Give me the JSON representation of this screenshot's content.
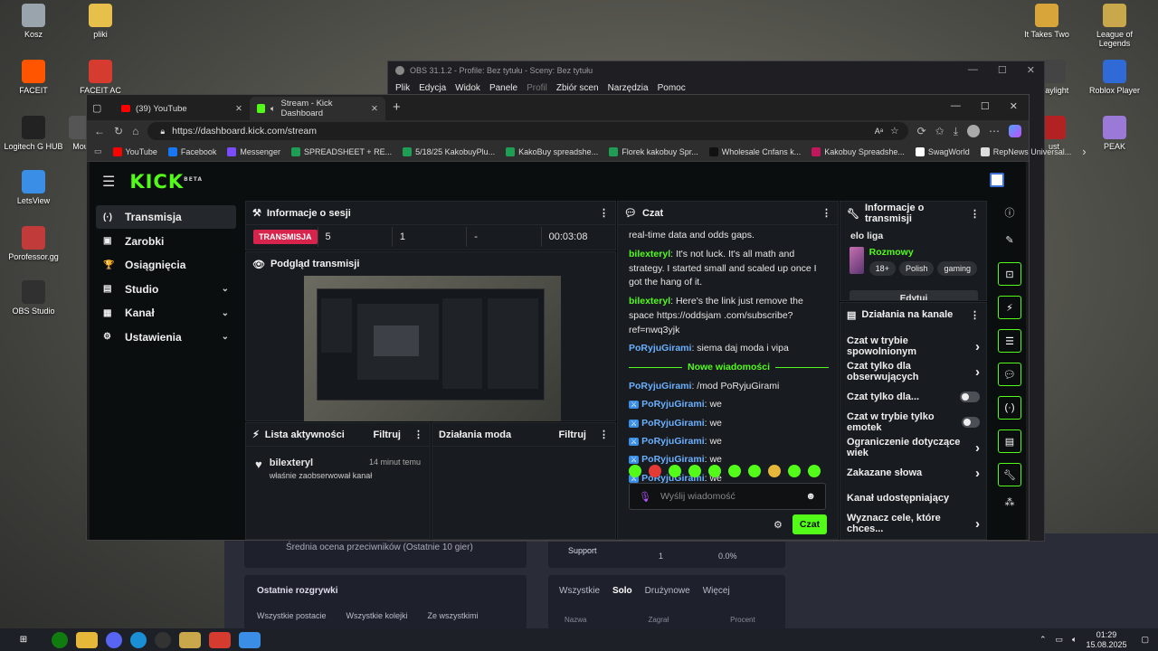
{
  "desktop": {
    "left_icons": [
      {
        "label": "Kosz",
        "color": "#9aa4ad"
      },
      {
        "label": "pliki",
        "color": "#e6c04a"
      },
      {
        "label": "FACEIT",
        "color": "#ff5500"
      },
      {
        "label": "FACEIT AC",
        "color": "#d63b2f"
      },
      {
        "label": "Logitech G HUB",
        "color": "#222222"
      },
      {
        "label": "Mou",
        "color": "#555555"
      },
      {
        "label": "LetsView",
        "color": "#3a8ee6"
      },
      {
        "label": "Porofessor.gg",
        "color": "#c23b3b"
      },
      {
        "label": "OBS Studio",
        "color": "#303030"
      }
    ],
    "right_icons": [
      {
        "label": "It Takes Two",
        "color": "#d8a53a"
      },
      {
        "label": "League of Legends",
        "color": "#c8a84a"
      },
      {
        "label": "Daylight",
        "color": "#444444"
      },
      {
        "label": "Roblox Player",
        "color": "#2f6ad6"
      },
      {
        "label": "ust",
        "color": "#b22222"
      },
      {
        "label": "PEAK",
        "color": "#9a7ad6"
      }
    ]
  },
  "obs": {
    "title": "OBS 31.1.2 - Profile: Bez tytułu - Sceny: Bez tytułu",
    "menu": [
      "Plik",
      "Edycja",
      "Widok",
      "Panele",
      "Profil",
      "Zbiór scen",
      "Narzędzia",
      "Pomoc"
    ]
  },
  "game_bg": {
    "avg_rating": "Średnia ocena przeciwników (Ostatnie 10 gier)",
    "recent_games": "Ostatnie rozgrywki",
    "filters": [
      "Wszystkie postacie",
      "Wszystkie kolejki",
      "Ze wszystkimi"
    ],
    "role": "Support",
    "role_value": "1",
    "role_pct": "0.0%",
    "tabs": [
      "Wszystkie",
      "Solo",
      "Drużynowe",
      "Więcej"
    ],
    "cols": [
      "Nazwa",
      "Zagrał",
      "Procent"
    ]
  },
  "browser": {
    "tabs": [
      {
        "label": "(39) YouTube",
        "active": false
      },
      {
        "label": "Stream - Kick Dashboard",
        "active": true
      }
    ],
    "url": "https://dashboard.kick.com/stream",
    "bookmarks": [
      {
        "label": "YouTube",
        "color": "#ff0000"
      },
      {
        "label": "Facebook",
        "color": "#1877f2"
      },
      {
        "label": "Messenger",
        "color": "#7b4bff"
      },
      {
        "label": "SPREADSHEET + RE...",
        "color": "#1e9e55"
      },
      {
        "label": "5/18/25 KakobuyPlu...",
        "color": "#1e9e55"
      },
      {
        "label": "KakoBuy spreadshe...",
        "color": "#1e9e55"
      },
      {
        "label": "Florek kakobuy Spr...",
        "color": "#1e9e55"
      },
      {
        "label": "Wholesale Cnfans k...",
        "color": "#111111"
      },
      {
        "label": "Kakobuy Spreadshe...",
        "color": "#c2185b"
      },
      {
        "label": "SwagWorld",
        "color": "#ffffff"
      },
      {
        "label": "RepNews Universal...",
        "color": "#dddddd"
      }
    ]
  },
  "kick": {
    "logo": "KICK",
    "logo_sup": "BETA",
    "nav": [
      {
        "label": "Transmisja",
        "icon": "(·)",
        "active": true,
        "chev": false
      },
      {
        "label": "Zarobki",
        "icon": "▣",
        "active": false,
        "chev": false
      },
      {
        "label": "Osiągnięcia",
        "icon": "🏆",
        "active": false,
        "chev": false
      },
      {
        "label": "Studio",
        "icon": "▤",
        "active": false,
        "chev": true
      },
      {
        "label": "Kanał",
        "icon": "▦",
        "active": false,
        "chev": true
      },
      {
        "label": "Ustawienia",
        "icon": "⚙",
        "active": false,
        "chev": true
      }
    ],
    "session": {
      "title": "Informacje o sesji",
      "live": "TRANSMISJA",
      "stats": [
        "5",
        "1",
        "-",
        "00:03:08"
      ]
    },
    "preview": {
      "title": "Podgląd transmisji"
    },
    "activity": {
      "title": "Lista aktywności",
      "filter": "Filtruj",
      "user": "bilexteryl",
      "time": "14 minut temu",
      "text": "właśnie zaobserwował kanał"
    },
    "mod": {
      "title": "Działania moda",
      "filter": "Filtruj"
    },
    "chat": {
      "title": "Czat",
      "partial": "real-time data and odds gaps.",
      "messages": [
        {
          "user": "bilexteryl",
          "color": "#53fc18",
          "text": ": It's not luck. It's all math and strategy. I started small and scaled up once I got the hang of it."
        },
        {
          "user": "bilexteryl",
          "color": "#53fc18",
          "text": ": Here's the link just remove the space https://oddsjam .com/subscribe?ref=nwq3yjk"
        },
        {
          "user": "PoRyjuGirami",
          "color": "#6ab0ff",
          "text": ": siema daj moda i vipa"
        }
      ],
      "new_label": "Nowe wiadomości",
      "new_messages": [
        {
          "user": "PoRyjuGirami",
          "text": ": /mod PoRyjuGirami",
          "badge": false
        },
        {
          "user": "PoRyjuGirami",
          "text": ": we",
          "badge": true
        },
        {
          "user": "PoRyjuGirami",
          "text": ": we",
          "badge": true
        },
        {
          "user": "PoRyjuGirami",
          "text": ": we",
          "badge": true
        },
        {
          "user": "PoRyjuGirami",
          "text": ": we",
          "badge": true
        },
        {
          "user": "PoRyjuGirami",
          "text": ": we",
          "badge": true
        }
      ],
      "placeholder": "Wyślij wiadomość",
      "send": "Czat"
    },
    "stream_info": {
      "title": "Informacje o transmisji",
      "stream_title": "elo liga",
      "category": "Rozmowy",
      "tags": [
        "18+",
        "Polish",
        "gaming"
      ],
      "edit": "Edytuj"
    },
    "channel_actions": {
      "title": "Działania na kanale",
      "items": [
        {
          "label": "Czat w trybie spowolnionym",
          "type": "chevron"
        },
        {
          "label": "Czat tylko dla obserwujących",
          "type": "chevron"
        },
        {
          "label": "Czat tylko dla...",
          "type": "toggle"
        },
        {
          "label": "Czat w trybie tylko emotek",
          "type": "toggle"
        },
        {
          "label": "Ograniczenie dotyczące wiek",
          "type": "chevron"
        },
        {
          "label": "Zakazane słowa",
          "type": "chevron"
        },
        {
          "label": "Kanał udostępniający",
          "type": "none"
        },
        {
          "label": "Wyznacz cele, które chces...",
          "type": "chevron"
        }
      ]
    }
  },
  "taskbar": {
    "time": "01:29",
    "date": "15.08.2025"
  }
}
